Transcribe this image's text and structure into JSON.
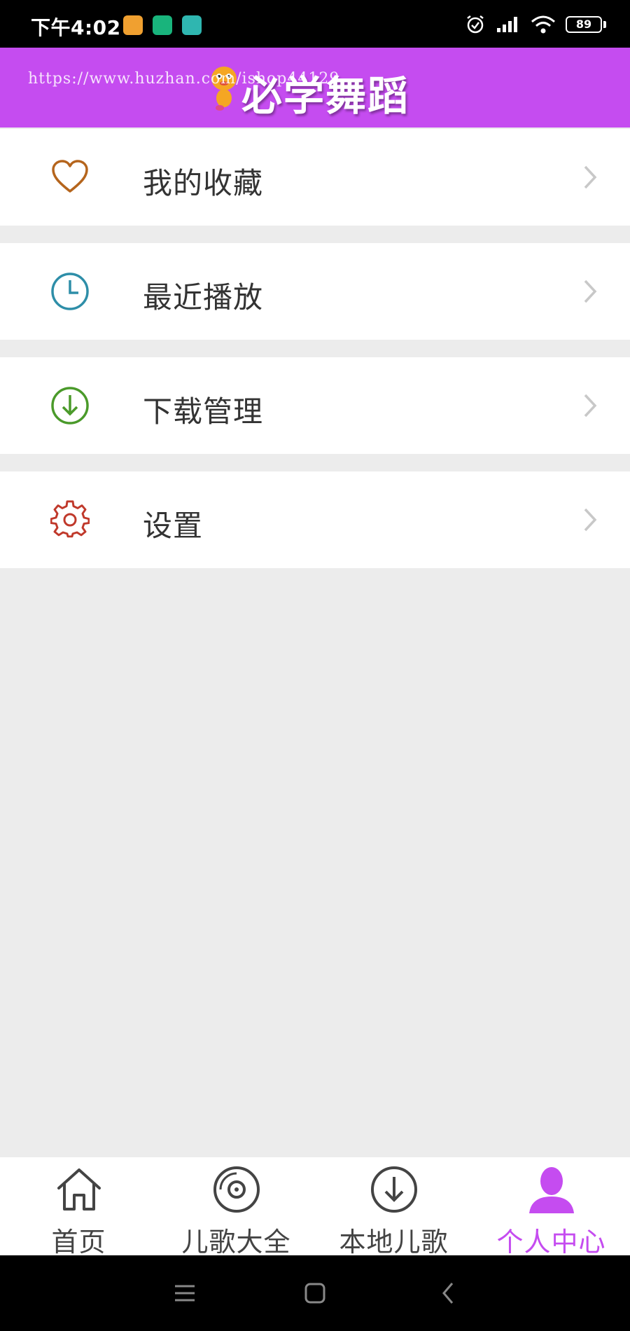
{
  "status_bar": {
    "time": "下午4:02",
    "badge_colors": [
      "#f0a030",
      "#19b47c",
      "#2fb6b0"
    ],
    "battery": "89"
  },
  "header": {
    "title": "必学舞蹈",
    "watermark": "https://www.huzhan.com/ishop44129",
    "bg_color": "#c54cf0"
  },
  "menu": [
    {
      "label": "我的收藏",
      "icon": "heart-icon",
      "color": "#b5651d"
    },
    {
      "label": "最近播放",
      "icon": "clock-icon",
      "color": "#2e8ea8"
    },
    {
      "label": "下载管理",
      "icon": "download-circle-icon",
      "color": "#4a9a2a"
    },
    {
      "label": "设置",
      "icon": "gear-icon",
      "color": "#c0392b"
    }
  ],
  "bottom_nav": [
    {
      "label": "首页",
      "icon": "home-icon",
      "active": false
    },
    {
      "label": "儿歌大全",
      "icon": "disc-icon",
      "active": false
    },
    {
      "label": "本地儿歌",
      "icon": "download-circle-icon",
      "active": false
    },
    {
      "label": "个人中心",
      "icon": "person-icon",
      "active": true
    }
  ],
  "accent_color": "#c54cf0"
}
